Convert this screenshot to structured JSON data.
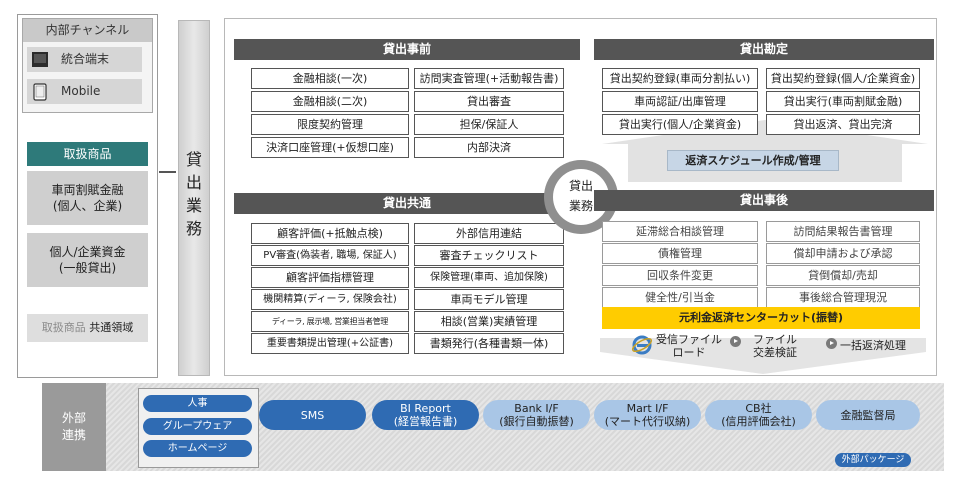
{
  "left_panel": {
    "internal_channel": {
      "title": "内部チャンネル",
      "items": [
        {
          "label": "統合端末",
          "icon": "terminal-icon"
        },
        {
          "label": "Mobile",
          "icon": "tablet-icon"
        }
      ]
    },
    "products": {
      "title": "取扱商品",
      "items": [
        {
          "line1": "車両割賦金融",
          "line2": "(個人、企業)"
        },
        {
          "line1": "個人/企業資金",
          "line2": "(一般貸出)"
        }
      ],
      "common_pale": "取扱商品",
      "common_dark": "共通領域"
    }
  },
  "business_label": "貸出業務",
  "center_circle": {
    "line1": "貸出",
    "line2": "業務"
  },
  "sections": {
    "pre_loan": {
      "title": "貸出事前",
      "col1": [
        "金融相談(一次)",
        "金融相談(二次)",
        "限度契約管理",
        "決済口座管理(+仮想口座)"
      ],
      "col2": [
        "訪問実査管理(+活動報告書)",
        "貸出審査",
        "担保/保証人",
        "内部決済"
      ]
    },
    "loan_account": {
      "title": "貸出勘定",
      "col1": [
        "貸出契約登録(車両分割払い)",
        "車両認証/出庫管理",
        "貸出実行(個人/企業資金)"
      ],
      "col2": [
        "貸出契約登録(個人/企業資金)",
        "貸出実行(車両割賦金融)",
        "貸出返済、貸出完済"
      ],
      "schedule": "返済スケジュール作成/管理"
    },
    "loan_common": {
      "title": "貸出共通",
      "col1": [
        "顧客評価(+抵触点検)",
        "PV審査(偽装者, 職場, 保証人)",
        "顧客評価指標管理",
        "機関精算(ディーラ, 保険会社)",
        "ディーラ, 展示場, 営業担当者管理",
        "重要書類提出管理(+公証書)"
      ],
      "col2": [
        "外部信用連結",
        "審査チェックリスト",
        "保険管理(車両、追加保険)",
        "車両モデル管理",
        "相談(営業)実績管理",
        "書類発行(各種書類一体)"
      ]
    },
    "post_loan": {
      "title": "貸出事後",
      "col1": [
        "延滞総合相談管理",
        "債権管理",
        "回収条件変更",
        "健全性/引当金"
      ],
      "col2": [
        "訪問結果報告書管理",
        "償却申請および承認",
        "貸倒償却/売却",
        "事後総合管理現況"
      ],
      "highlight": "元利金返済センターカット(振替)",
      "file_upload": {
        "line1": "受信ファイル",
        "line2": "ロード"
      },
      "file_verify": {
        "line1": "ファイル",
        "line2": "交差検証"
      },
      "bulk": "一括返済処理"
    }
  },
  "external": {
    "label_line1": "外部",
    "label_line2": "連携",
    "misc": [
      "人事",
      "グループウェア",
      "ホームページ"
    ],
    "systems": [
      {
        "line1": "SMS",
        "line2": "",
        "style": "dark"
      },
      {
        "line1": "BI Report",
        "line2": "(経営報告書)",
        "style": "dark"
      },
      {
        "line1": "Bank I/F",
        "line2": "(銀行自動振替)",
        "style": "light"
      },
      {
        "line1": "Mart I/F",
        "line2": "(マート代行収納)",
        "style": "light"
      },
      {
        "line1": "CB社",
        "line2": "(信用評価会社)",
        "style": "light"
      },
      {
        "line1": "金融監督局",
        "line2": "",
        "style": "light"
      }
    ],
    "package_label": "外部パッケージ"
  },
  "colors": {
    "section_header": "#555555",
    "product_header": "#2e7a7a",
    "pill_dark": "#2f6bb3",
    "pill_light": "#a9c6e6",
    "highlight": "#ffcc00"
  }
}
